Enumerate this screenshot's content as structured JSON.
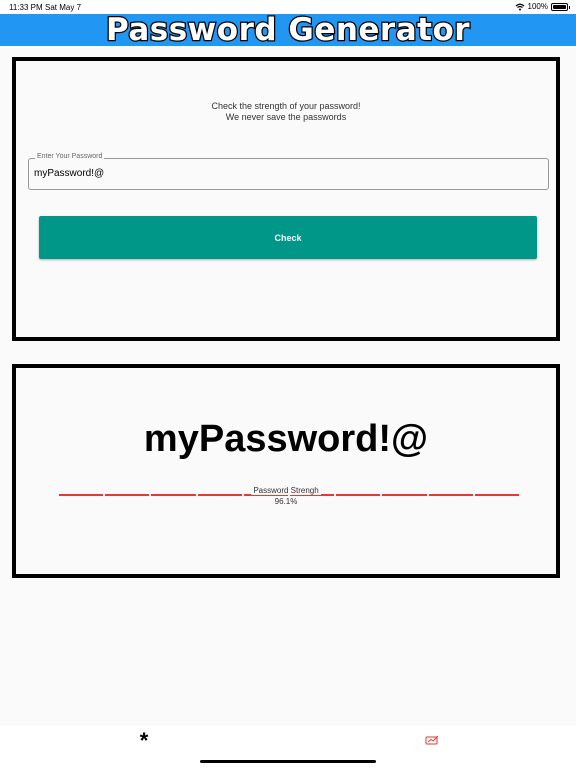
{
  "status_bar": {
    "time": "11:33 PM",
    "date": "Sat May 7",
    "battery": "100%"
  },
  "app_bar": {
    "title": "Password Generator"
  },
  "checker": {
    "intro_line1": "Check the strength of your password!",
    "intro_line2": "We never save the passwords",
    "field_label": "Enter Your Password",
    "field_value": "myPassword!@",
    "check_label": "Check"
  },
  "result": {
    "password": "myPassword!@",
    "strength_label": "Password Strengh",
    "strength_value": "96.1%",
    "strength_fraction": 0.961,
    "segment_count": 10
  },
  "colors": {
    "app_bar": "#2196f3",
    "button": "#009688",
    "strength": "#e53935"
  },
  "nav": {
    "generate_icon": "asterisk-icon",
    "check_icon": "signature-icon"
  }
}
